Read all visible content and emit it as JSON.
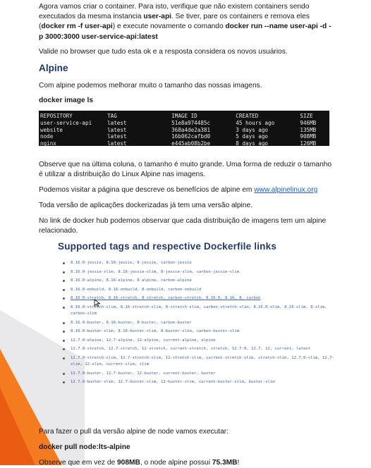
{
  "intro": {
    "s1": "Agora vamos criar o container. Para isto, verifique que não existem containers sendo executados da mesma instancia ",
    "b1": "user-api",
    "s2": ". Se tiver, pare os containers e remova eles (",
    "b2": "docker rm -f user-api",
    "s3": ") e execute novamente o comando ",
    "b3": "docker run --name user-api -d -p 3000:3000 user-service-api:latest"
  },
  "validate_text": "Valide no browser que tudo esta ok e a resposta considera os novos usuários.",
  "alpine_heading": "Alpine",
  "alpine_intro": "Com alpine podemos melhorar muito o tamanho das nossas imagens.",
  "images_cmd": "docker image ls",
  "terminal": {
    "headers": [
      "REPOSITORY",
      "TAG",
      "IMAGE ID",
      "CREATED",
      "SIZE"
    ],
    "rows": [
      [
        "user-service-api",
        "latest",
        "51e8a974485c",
        "45 hours ago",
        "946MB"
      ],
      [
        "website",
        "latest",
        "368a4de2a381",
        "3 days ago",
        "135MB"
      ],
      [
        "node",
        "latest",
        "16b062cafbd0",
        "5 days ago",
        "908MB"
      ],
      [
        "nginx",
        "latest",
        "e445ab08b2be",
        "8 days ago",
        "126MB"
      ]
    ]
  },
  "size_note": "Observe que na última coluna, o tamanho é muito grande. Uma forma de reduzir o tamanho é utilizar a distribuição do Linux Alpine nas imagens.",
  "visit_text": "Podemos visitar a página que descreve os benefícios de alpine em ",
  "visit_link": "www.alpinelinux.org",
  "alpine_versions": "Toda versão de aplicações dockerizadas já tem uma versão alpine.",
  "hub_note": "No link de docker hub podemos observar que cada distribuição de imagens tem um alpine relacionado.",
  "tags_screenshot": {
    "heading": "Supported tags and respective Dockerfile links",
    "items": [
      "8.16.0-jessie, 8.16-jessie, 8-jessie, carbon-jessie",
      "8.16.0-jessie-slim, 8.16-jessie-slim, 8-jessie-slim, carbon-jessie-slim",
      "8.16.0-alpine, 8.16-alpine, 8-alpine, carbon-alpine",
      "8.16.0-onbuild, 8.16-onbuild, 8-onbuild, carbon-onbuild",
      "8.16.0-stretch, 8.16-stretch, 8-stretch, carbon-stretch, 8.16.0, 8.16, 8, carbon",
      "8.16.0-stretch-slim, 8.16-stretch-slim, 8-stretch-slim, carbon-stretch-slim, 8.16.0-slim, 8.16-slim, 8-slim, carbon-slim",
      "8.16.0-buster, 8.16-buster, 8-buster, carbon-buster",
      "8.16.0-buster-slim, 8.16-buster-slim, 8-buster-slim, carbon-buster-slim",
      "12.7.0-alpine, 12.7-alpine, 12-alpine, current-alpine, alpine",
      "12.7.0-stretch, 12.7-stretch, 12-stretch, current-stretch, stretch, 12.7.0, 12.7, 12, current, latest",
      "12.7.0-stretch-slim, 12.7-stretch-slim, 12-stretch-slim, current-stretch-slim, stretch-slim, 12.7.0-slim, 12.7-slim, 12-slim, current-slim, slim",
      "12.7.0-buster, 12.7-buster, 12-buster, current-buster, buster",
      "12.7.0-buster-slim, 12.7-buster-slim, 12-buster-slim, current-buster-slim, buster-slim"
    ]
  },
  "pull_intro": "Para fazer o pull da versão alpine de node vamos executar:",
  "pull_cmd": "docker pull node:lts-alpine",
  "size_compare": {
    "s1": "Observe que em vez de ",
    "b1": "908MB",
    "s2": ", o node alpine possui ",
    "b2": "75.3MB",
    "s3": "!"
  },
  "colors": {
    "heading": "#1f3864",
    "link": "#1f5fbf",
    "terminal_bg": "#111111",
    "tag_text": "#3a5fa8",
    "decor_orange": "#f47b20"
  }
}
